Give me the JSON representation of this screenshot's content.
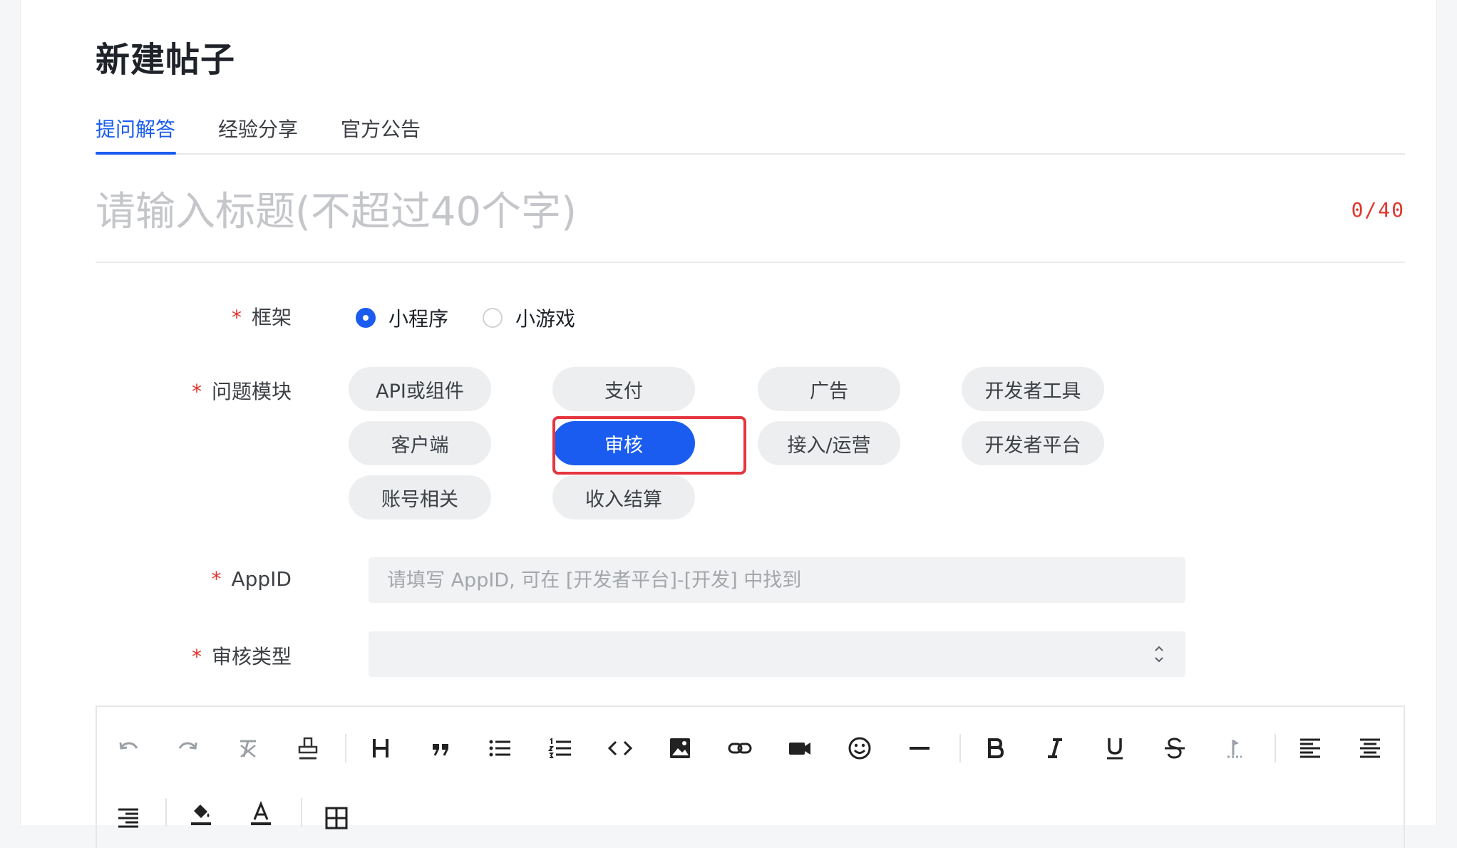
{
  "page": {
    "title": "新建帖子"
  },
  "tabs": [
    {
      "label": "提问解答",
      "active": true
    },
    {
      "label": "经验分享",
      "active": false
    },
    {
      "label": "官方公告",
      "active": false
    }
  ],
  "title_field": {
    "placeholder": "请输入标题(不超过40个字)",
    "value": "",
    "counter": "0/40"
  },
  "form": {
    "required_mark": "*",
    "framework": {
      "label": "框架",
      "options": [
        {
          "label": "小程序",
          "checked": true
        },
        {
          "label": "小游戏",
          "checked": false
        }
      ]
    },
    "module": {
      "label": "问题模块",
      "chips": [
        {
          "label": "API或组件",
          "selected": false
        },
        {
          "label": "支付",
          "selected": false
        },
        {
          "label": "广告",
          "selected": false
        },
        {
          "label": "开发者工具",
          "selected": false
        },
        {
          "label": "客户端",
          "selected": false
        },
        {
          "label": "审核",
          "selected": true
        },
        {
          "label": "接入/运营",
          "selected": false
        },
        {
          "label": "开发者平台",
          "selected": false
        },
        {
          "label": "账号相关",
          "selected": false
        },
        {
          "label": "收入结算",
          "selected": false
        }
      ]
    },
    "appid": {
      "label": "AppID",
      "placeholder": "请填写 AppID, 可在 [开发者平台]-[开发] 中找到",
      "value": ""
    },
    "review_type": {
      "label": "审核类型",
      "value": ""
    }
  },
  "toolbar": {
    "buttons": [
      "undo-icon",
      "redo-icon",
      "clear-format-icon",
      "format-painter-icon",
      "heading-icon",
      "quote-icon",
      "bullet-list-icon",
      "numbered-list-icon",
      "code-icon",
      "image-icon",
      "link-icon",
      "video-icon",
      "emoji-icon",
      "divider-icon",
      "bold-icon",
      "italic-icon",
      "underline-icon",
      "strikethrough-icon",
      "wand-icon",
      "align-left-icon",
      "align-center-icon",
      "align-right-icon",
      "fill-color-icon",
      "font-color-icon",
      "table-icon"
    ]
  },
  "colors": {
    "accent": "#1a5cf0",
    "required": "#e0342c",
    "chip_bg": "#eceef0",
    "field_bg": "#f1f2f3",
    "highlight": "#e5353f"
  }
}
